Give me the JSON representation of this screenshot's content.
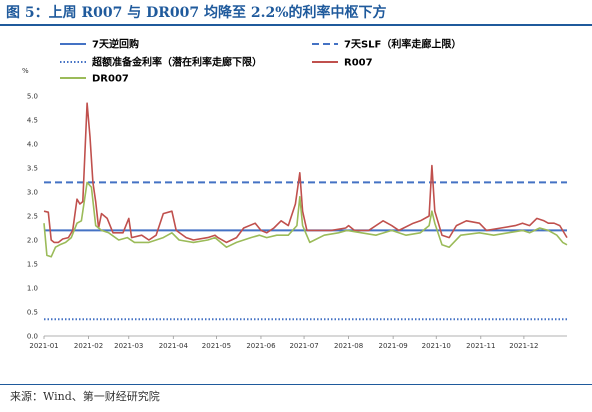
{
  "header": {
    "title": "图 5：上周 R007 与 DR007 均降至 2.2%的利率中枢下方"
  },
  "footer": {
    "source": "来源：Wind、第一财经研究院"
  },
  "chart_data": {
    "type": "line",
    "y_unit": "%",
    "ylim": [
      0,
      5.0
    ],
    "y_ticks": [
      "0.0",
      "0.5",
      "1.0",
      "1.5",
      "2.0",
      "2.5",
      "3.0",
      "3.5",
      "4.0",
      "4.5",
      "5.0"
    ],
    "x_range": [
      "2021-01",
      "2021-12"
    ],
    "x_ticks": [
      "2021-01",
      "2021-02",
      "2021-03",
      "2021-04",
      "2021-05",
      "2021-06",
      "2021-07",
      "2021-08",
      "2021-09",
      "2021-10",
      "2021-11",
      "2021-12"
    ],
    "grid": false,
    "legend_position": "top",
    "series": [
      {
        "name": "7天逆回购",
        "style": "solid",
        "color": "#4472c4",
        "points": [
          [
            "2021-01-01",
            2.2
          ],
          [
            "2021-12-31",
            2.2
          ]
        ]
      },
      {
        "name": "7天SLF（利率走廊上限）",
        "style": "dashed",
        "color": "#4472c4",
        "points": [
          [
            "2021-01-01",
            3.2
          ],
          [
            "2021-12-31",
            3.2
          ]
        ]
      },
      {
        "name": "超额准备金利率（潜在利率走廊下限）",
        "style": "dotted",
        "color": "#4472c4",
        "points": [
          [
            "2021-01-01",
            0.35
          ],
          [
            "2021-12-31",
            0.35
          ]
        ]
      },
      {
        "name": "R007",
        "style": "solid",
        "color": "#c0504d",
        "points": [
          [
            "2021-01-01",
            2.6
          ],
          [
            "2021-01-04",
            2.58
          ],
          [
            "2021-01-06",
            2.0
          ],
          [
            "2021-01-08",
            1.95
          ],
          [
            "2021-01-11",
            1.95
          ],
          [
            "2021-01-14",
            2.02
          ],
          [
            "2021-01-18",
            2.05
          ],
          [
            "2021-01-21",
            2.2
          ],
          [
            "2021-01-24",
            2.85
          ],
          [
            "2021-01-26",
            2.75
          ],
          [
            "2021-01-28",
            2.8
          ],
          [
            "2021-01-31",
            4.85
          ],
          [
            "2021-02-02",
            4.15
          ],
          [
            "2021-02-04",
            3.2
          ],
          [
            "2021-02-06",
            2.8
          ],
          [
            "2021-02-08",
            2.25
          ],
          [
            "2021-02-10",
            2.55
          ],
          [
            "2021-02-14",
            2.45
          ],
          [
            "2021-02-18",
            2.15
          ],
          [
            "2021-02-25",
            2.15
          ],
          [
            "2021-03-01",
            2.45
          ],
          [
            "2021-03-03",
            2.05
          ],
          [
            "2021-03-10",
            2.1
          ],
          [
            "2021-03-15",
            2.0
          ],
          [
            "2021-03-20",
            2.1
          ],
          [
            "2021-03-25",
            2.55
          ],
          [
            "2021-03-31",
            2.6
          ],
          [
            "2021-04-03",
            2.2
          ],
          [
            "2021-04-10",
            2.05
          ],
          [
            "2021-04-15",
            2.0
          ],
          [
            "2021-04-25",
            2.05
          ],
          [
            "2021-04-30",
            2.1
          ],
          [
            "2021-05-02",
            2.05
          ],
          [
            "2021-05-08",
            1.95
          ],
          [
            "2021-05-15",
            2.05
          ],
          [
            "2021-05-20",
            2.25
          ],
          [
            "2021-05-28",
            2.35
          ],
          [
            "2021-06-01",
            2.2
          ],
          [
            "2021-06-05",
            2.15
          ],
          [
            "2021-06-10",
            2.25
          ],
          [
            "2021-06-15",
            2.4
          ],
          [
            "2021-06-20",
            2.3
          ],
          [
            "2021-06-25",
            2.75
          ],
          [
            "2021-06-28",
            3.4
          ],
          [
            "2021-06-30",
            2.6
          ],
          [
            "2021-07-03",
            2.2
          ],
          [
            "2021-07-10",
            2.2
          ],
          [
            "2021-07-20",
            2.2
          ],
          [
            "2021-07-30",
            2.25
          ],
          [
            "2021-08-01",
            2.3
          ],
          [
            "2021-08-05",
            2.2
          ],
          [
            "2021-08-15",
            2.2
          ],
          [
            "2021-08-25",
            2.4
          ],
          [
            "2021-08-31",
            2.3
          ],
          [
            "2021-09-05",
            2.2
          ],
          [
            "2021-09-15",
            2.35
          ],
          [
            "2021-09-20",
            2.4
          ],
          [
            "2021-09-26",
            2.5
          ],
          [
            "2021-09-28",
            3.55
          ],
          [
            "2021-09-30",
            2.6
          ],
          [
            "2021-10-05",
            2.1
          ],
          [
            "2021-10-10",
            2.05
          ],
          [
            "2021-10-15",
            2.3
          ],
          [
            "2021-10-22",
            2.4
          ],
          [
            "2021-10-31",
            2.35
          ],
          [
            "2021-11-05",
            2.2
          ],
          [
            "2021-11-15",
            2.25
          ],
          [
            "2021-11-25",
            2.3
          ],
          [
            "2021-11-30",
            2.35
          ],
          [
            "2021-12-05",
            2.3
          ],
          [
            "2021-12-10",
            2.45
          ],
          [
            "2021-12-15",
            2.4
          ],
          [
            "2021-12-18",
            2.35
          ],
          [
            "2021-12-22",
            2.35
          ],
          [
            "2021-12-26",
            2.3
          ],
          [
            "2021-12-31",
            2.05
          ]
        ]
      },
      {
        "name": "DR007",
        "style": "solid",
        "color": "#9bbb59",
        "points": [
          [
            "2021-01-01",
            2.35
          ],
          [
            "2021-01-03",
            1.68
          ],
          [
            "2021-01-06",
            1.65
          ],
          [
            "2021-01-09",
            1.85
          ],
          [
            "2021-01-12",
            1.9
          ],
          [
            "2021-01-16",
            1.95
          ],
          [
            "2021-01-20",
            2.05
          ],
          [
            "2021-01-24",
            2.35
          ],
          [
            "2021-01-27",
            2.4
          ],
          [
            "2021-01-31",
            3.2
          ],
          [
            "2021-02-03",
            3.1
          ],
          [
            "2021-02-06",
            2.3
          ],
          [
            "2021-02-10",
            2.2
          ],
          [
            "2021-02-15",
            2.15
          ],
          [
            "2021-02-22",
            2.0
          ],
          [
            "2021-02-28",
            2.05
          ],
          [
            "2021-03-05",
            1.95
          ],
          [
            "2021-03-15",
            1.95
          ],
          [
            "2021-03-25",
            2.05
          ],
          [
            "2021-03-31",
            2.15
          ],
          [
            "2021-04-05",
            2.0
          ],
          [
            "2021-04-15",
            1.95
          ],
          [
            "2021-04-25",
            2.0
          ],
          [
            "2021-04-30",
            2.05
          ],
          [
            "2021-05-08",
            1.85
          ],
          [
            "2021-05-15",
            1.95
          ],
          [
            "2021-05-25",
            2.05
          ],
          [
            "2021-05-31",
            2.1
          ],
          [
            "2021-06-05",
            2.05
          ],
          [
            "2021-06-12",
            2.1
          ],
          [
            "2021-06-20",
            2.1
          ],
          [
            "2021-06-26",
            2.3
          ],
          [
            "2021-06-28",
            2.9
          ],
          [
            "2021-06-30",
            2.3
          ],
          [
            "2021-07-05",
            1.95
          ],
          [
            "2021-07-15",
            2.1
          ],
          [
            "2021-07-25",
            2.15
          ],
          [
            "2021-07-31",
            2.2
          ],
          [
            "2021-08-10",
            2.15
          ],
          [
            "2021-08-20",
            2.1
          ],
          [
            "2021-08-31",
            2.2
          ],
          [
            "2021-09-10",
            2.1
          ],
          [
            "2021-09-20",
            2.15
          ],
          [
            "2021-09-26",
            2.3
          ],
          [
            "2021-09-28",
            2.6
          ],
          [
            "2021-09-30",
            2.35
          ],
          [
            "2021-10-05",
            1.9
          ],
          [
            "2021-10-10",
            1.85
          ],
          [
            "2021-10-18",
            2.1
          ],
          [
            "2021-10-31",
            2.15
          ],
          [
            "2021-11-10",
            2.1
          ],
          [
            "2021-11-20",
            2.15
          ],
          [
            "2021-11-30",
            2.2
          ],
          [
            "2021-12-05",
            2.15
          ],
          [
            "2021-12-12",
            2.25
          ],
          [
            "2021-12-18",
            2.2
          ],
          [
            "2021-12-24",
            2.1
          ],
          [
            "2021-12-28",
            1.95
          ],
          [
            "2021-12-31",
            1.9
          ]
        ]
      }
    ]
  }
}
